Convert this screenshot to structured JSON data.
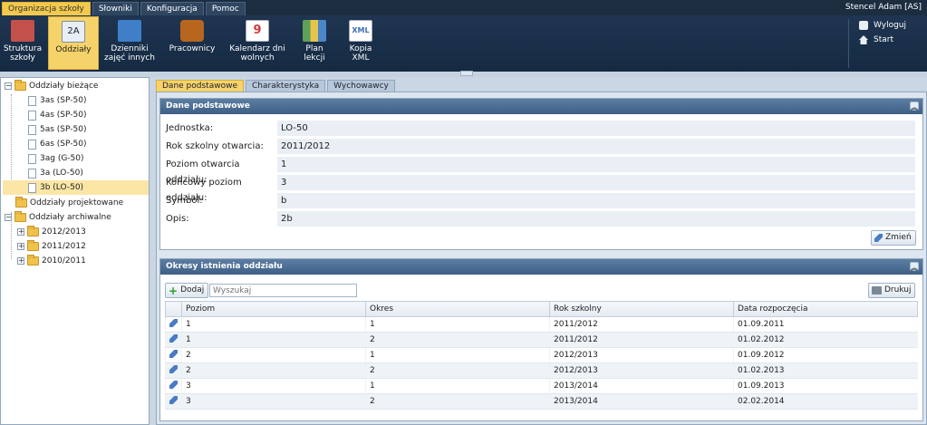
{
  "menu": {
    "tabs": [
      "Organizacja szkoły",
      "Słowniki",
      "Konfiguracja",
      "Pomoc"
    ],
    "user": "Stencel Adam [AS]"
  },
  "ribbon": {
    "buttons": [
      {
        "label": "Struktura szkoły",
        "icon": "school-structure-icon",
        "color": "#c4504a"
      },
      {
        "label": "Oddziały",
        "icon": "class-2a-icon",
        "color": "#e8eef5",
        "badge": "2A"
      },
      {
        "label": "Dzienniki zajęć innych",
        "icon": "journal-icon",
        "color": "#3f7fc8"
      },
      {
        "label": "Pracownicy",
        "icon": "briefcase-icon",
        "color": "#b8651e"
      },
      {
        "label": "Kalendarz dni wolnych",
        "icon": "calendar-icon",
        "color": "#d33a3a",
        "badge": "9"
      },
      {
        "label": "Plan lekcji",
        "icon": "schedule-icon",
        "color": "#5fa05a"
      },
      {
        "label": "Kopia XML",
        "icon": "xml-icon",
        "color": "#3a6fb5",
        "badge": "XML"
      }
    ],
    "logout": "Wyloguj",
    "start": "Start"
  },
  "tree": {
    "root_current": "Oddziały bieżące",
    "current_items": [
      "3as (SP-50)",
      "4as (SP-50)",
      "5as (SP-50)",
      "6as (SP-50)",
      "3ag (G-50)",
      "3a (LO-50)",
      "3b (LO-50)"
    ],
    "projected": "Oddziały projektowane",
    "archived": "Oddziały archiwalne",
    "archived_years": [
      "2012/2013",
      "2011/2012",
      "2010/2011"
    ]
  },
  "tabs": [
    "Dane podstawowe",
    "Charakterystyka",
    "Wychowawcy"
  ],
  "basic_panel": {
    "title": "Dane podstawowe",
    "fields": [
      {
        "label": "Jednostka:",
        "value": "LO-50"
      },
      {
        "label": "Rok szkolny otwarcia:",
        "value": "2011/2012"
      },
      {
        "label": "Poziom otwarcia oddziału:",
        "value": "1"
      },
      {
        "label": "Końcowy poziom oddziału:",
        "value": "3"
      },
      {
        "label": "Symbol:",
        "value": "b"
      },
      {
        "label": "Opis:",
        "value": "2b"
      }
    ],
    "edit_label": "Zmień"
  },
  "periods_panel": {
    "title": "Okresy istnienia oddziału",
    "add_label": "Dodaj",
    "search_placeholder": "Wyszukaj",
    "print_label": "Drukuj",
    "columns": [
      "Poziom",
      "Okres",
      "Rok szkolny",
      "Data rozpoczęcia"
    ],
    "rows": [
      [
        "1",
        "1",
        "2011/2012",
        "01.09.2011"
      ],
      [
        "1",
        "2",
        "2011/2012",
        "01.02.2012"
      ],
      [
        "2",
        "1",
        "2012/2013",
        "01.09.2012"
      ],
      [
        "2",
        "2",
        "2012/2013",
        "01.02.2013"
      ],
      [
        "3",
        "1",
        "2013/2014",
        "01.09.2013"
      ],
      [
        "3",
        "2",
        "2013/2014",
        "02.02.2014"
      ]
    ]
  }
}
